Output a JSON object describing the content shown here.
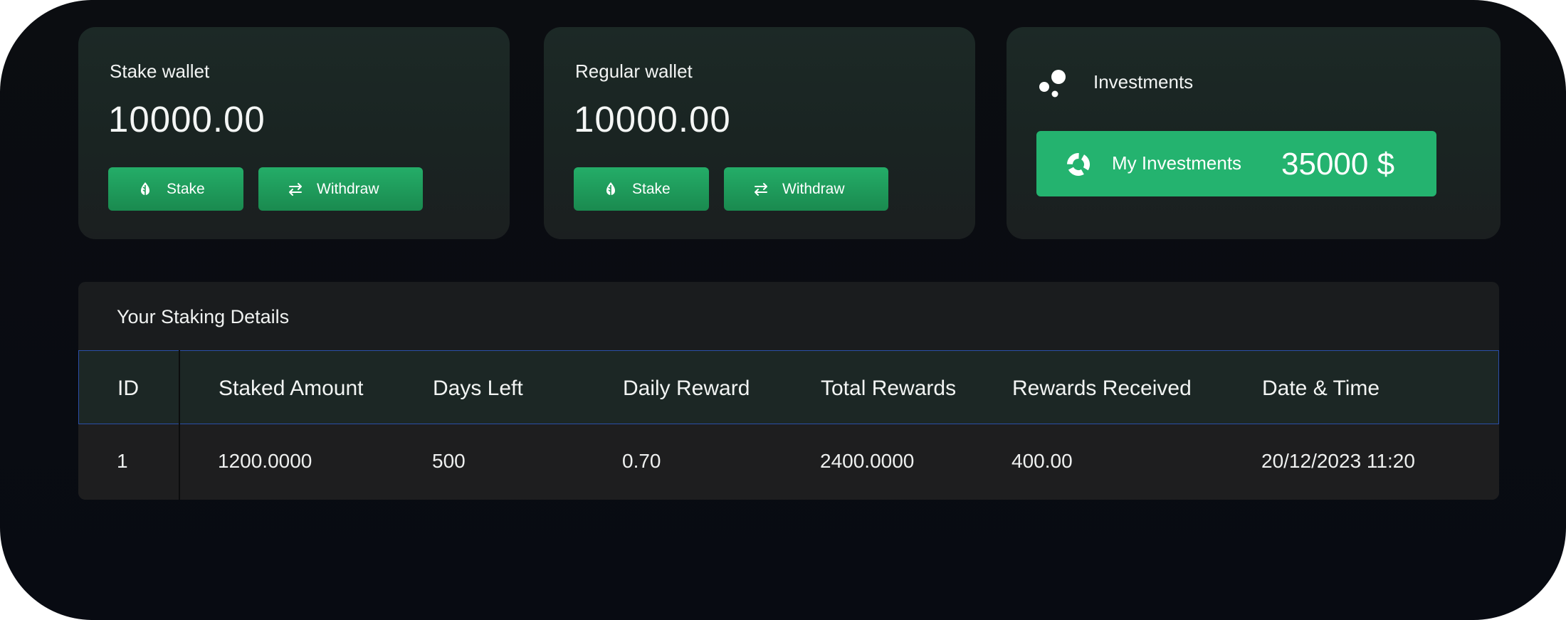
{
  "wallets": {
    "stake": {
      "title": "Stake wallet",
      "amount": "10000.00",
      "stake_label": "Stake",
      "withdraw_label": "Withdraw"
    },
    "regular": {
      "title": "Regular wallet",
      "amount": "10000.00",
      "stake_label": "Stake",
      "withdraw_label": "Withdraw"
    }
  },
  "investments": {
    "title": "Investments",
    "button_label": "My Investments",
    "value": "35000 $"
  },
  "staking_details": {
    "title": "Your Staking Details",
    "columns": [
      "ID",
      "Staked Amount",
      "Days Left",
      "Daily Reward",
      "Total Rewards",
      "Rewards Received",
      "Date & Time"
    ],
    "rows": [
      [
        "1",
        "1200.0000",
        "500",
        "0.70",
        "2400.0000",
        "400.00",
        "20/12/2023 11:20"
      ]
    ]
  },
  "colors": {
    "accent_green": "#24b36f",
    "background": "#0a0c10",
    "card": "#1c2624",
    "header_border": "#2b4fa8"
  },
  "icons": {
    "stake": "leaf-drop-icon",
    "withdraw": "swap-arrows-icon",
    "investments": "bubbles-icon",
    "my_investments": "donut-chart-icon"
  }
}
